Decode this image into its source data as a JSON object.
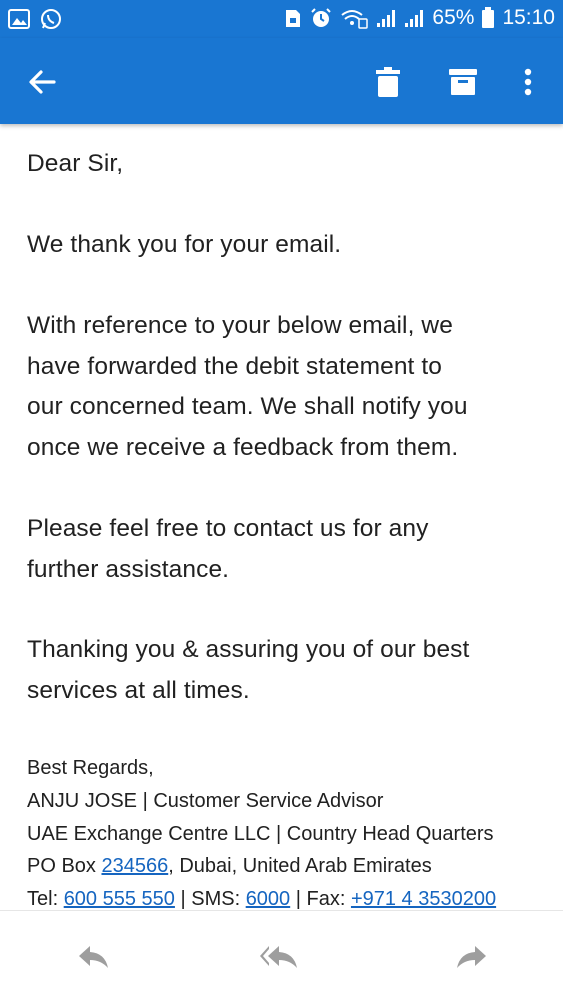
{
  "status_bar": {
    "battery_percent": "65%",
    "time": "15:10",
    "icons": [
      "gallery-icon",
      "whatsapp-icon",
      "sim-lock-icon",
      "alarm-icon",
      "wifi-icon",
      "signal-icon",
      "signal-icon",
      "battery-icon"
    ]
  },
  "toolbar": {
    "icons": [
      "back-arrow-icon",
      "delete-icon",
      "archive-icon",
      "more-vert-icon"
    ]
  },
  "email": {
    "greeting": "Dear Sir,",
    "para1": "We thank you for your email.",
    "para2_lines": [
      "With reference to your below email, we",
      "have forwarded the debit statement to",
      "our concerned team. We shall notify you",
      "once we receive a feedback from them."
    ],
    "para3_lines": [
      "Please feel free to contact us for any",
      "further assistance."
    ],
    "para4_lines": [
      "Thanking you & assuring you of our best",
      "services at all times."
    ],
    "signature": {
      "regards": "Best Regards,",
      "name_title": "ANJU JOSE | Customer Service Advisor",
      "company": "UAE Exchange Centre LLC | Country Head Quarters",
      "po_prefix": "PO Box ",
      "po_box": "234566",
      "po_suffix": ", Dubai, United Arab Emirates",
      "tel_prefix": "Tel: ",
      "tel": "600 555 550",
      "sms_prefix": " | SMS: ",
      "sms": "6000",
      "fax_prefix": " | Fax: ",
      "fax": "+971 4 3530200"
    }
  },
  "bottom_bar": {
    "icons": [
      "reply-icon",
      "reply-all-icon",
      "forward-icon"
    ]
  },
  "colors": {
    "primary": "#1976d2",
    "link": "#1565c0",
    "text": "#212121",
    "bottom_icon": "#9e9e9e"
  }
}
